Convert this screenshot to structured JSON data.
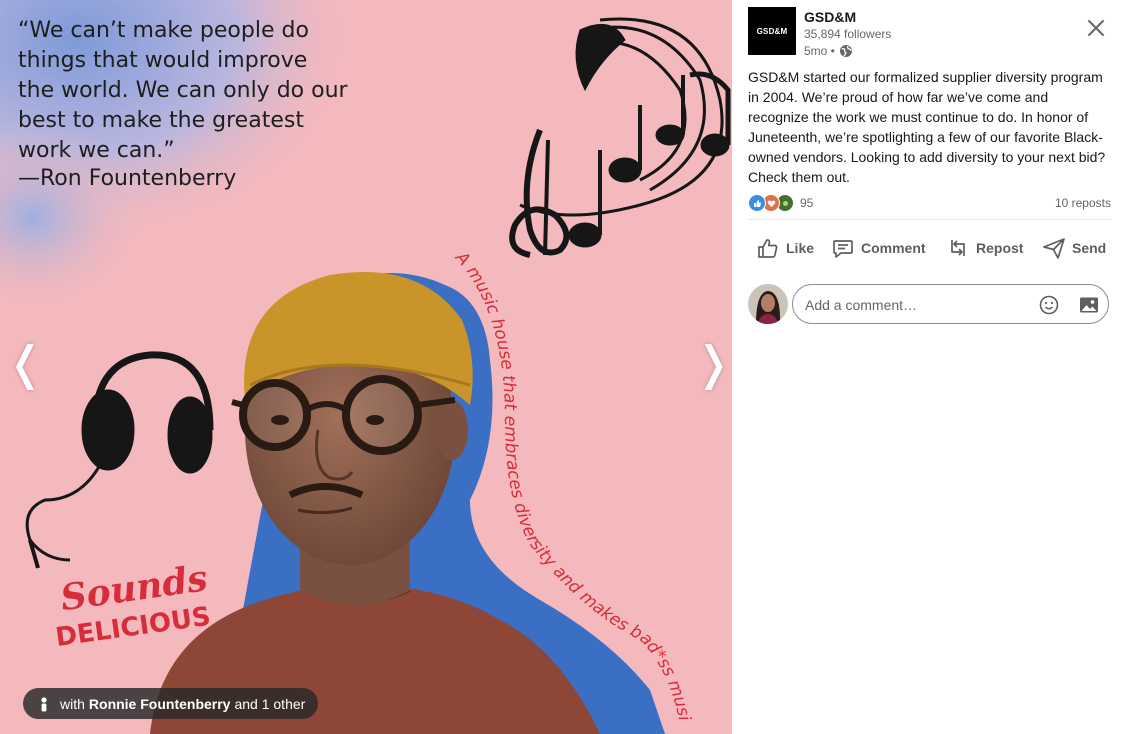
{
  "media": {
    "quote": "“We can’t make people do\nthings that would improve\nthe world. We can only do our\nbest to make the greatest\nwork we can.”",
    "quote_author": "—Ron Fountenberry",
    "tagline": "A music house that embraces diversity and makes bad*ss music",
    "stamp_line1": "Sounds",
    "stamp_line2": "DELICIOUS",
    "prev_arrow": "❬",
    "next_arrow": "❭",
    "tag_pill": {
      "prefix": "with",
      "name": "Ronnie Fountenberry",
      "suffix": "and 1 other"
    }
  },
  "post": {
    "logo_text": "GSD&M",
    "company": "GSD&M",
    "followers": "35,894 followers",
    "age": "5mo •",
    "body": "GSD&M started our formalized supplier diversity program in 2004. We’re proud of how far we’ve come and recognize the work we must continue to do. In honor of Juneteenth, we’re spotlighting a few of our favorite Black-owned vendors. Looking to add diversity to your next bid? Check them out.",
    "reaction_count": "95",
    "reposts": "10 reposts"
  },
  "actions": {
    "like": "Like",
    "comment": "Comment",
    "repost": "Repost",
    "send": "Send"
  },
  "comment": {
    "placeholder": "Add a comment…"
  },
  "colors": {
    "background_pink": "#f4b9bd",
    "accent_blue": "#3a6fc4",
    "stamp_red": "#d72c3a",
    "hat_mustard": "#c9952a",
    "shirt_rust": "#8e4636"
  }
}
